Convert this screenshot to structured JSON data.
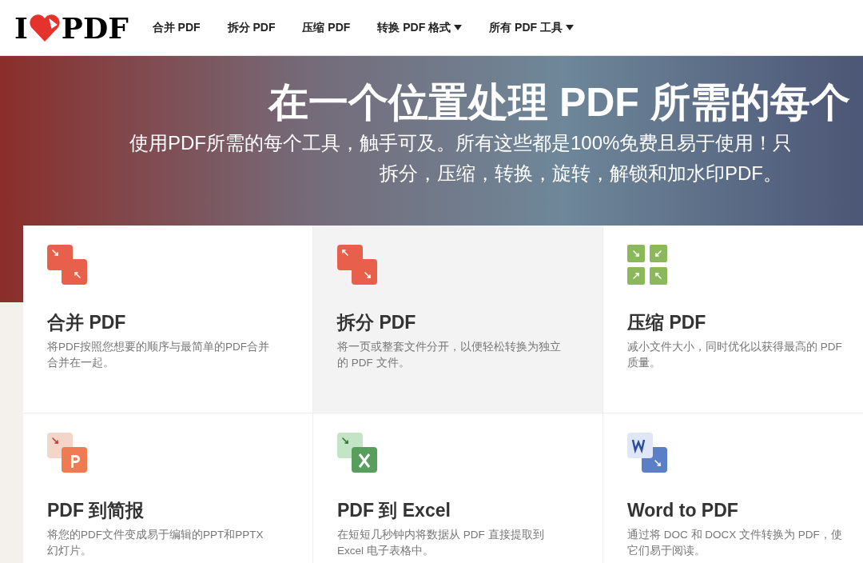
{
  "header": {
    "logo": {
      "left": "I",
      "right": "PDF"
    },
    "nav": [
      {
        "label": "合并 PDF",
        "dropdown": false
      },
      {
        "label": "拆分 PDF",
        "dropdown": false
      },
      {
        "label": "压缩 PDF",
        "dropdown": false
      },
      {
        "label": "转换 PDF 格式",
        "dropdown": true
      },
      {
        "label": "所有 PDF 工具",
        "dropdown": true
      }
    ]
  },
  "hero": {
    "title": "在一个位置处理 PDF 所需的每个",
    "subtitle_lines": [
      "使用PDF所需的每个工具，触手可及。所有这些都是100%免费且易于使用！只",
      "拆分，压缩，转换，旋转，解锁和加水印PDF。"
    ]
  },
  "tools": [
    {
      "kind": "merge",
      "title": "合并 PDF",
      "description_lines": [
        "将PDF按照您想要的顺序与最简单的PDF合并",
        "合并在一起。"
      ],
      "selected": false
    },
    {
      "kind": "split",
      "title": "拆分 PDF",
      "description_lines": [
        "将一页或整套文件分开，以便轻松转换为独立",
        "的 PDF 文件。"
      ],
      "selected": true
    },
    {
      "kind": "compress",
      "title": "压缩 PDF",
      "description_lines": [
        "减小文件大小，同时优化以获得最高的 PDF",
        "质量。"
      ],
      "selected": false
    },
    {
      "kind": "ppt",
      "title": "PDF 到简报",
      "description_lines": [
        "将您的PDF文件变成易于编辑的PPT和PPTX",
        "幻灯片。"
      ],
      "selected": false
    },
    {
      "kind": "excel",
      "title": "PDF 到 Excel",
      "description_lines": [
        "在短短几秒钟内将数据从 PDF 直接提取到",
        "Excel 电子表格中。"
      ],
      "selected": false
    },
    {
      "kind": "word",
      "title": "Word to PDF",
      "description_lines": [
        "通过将 DOC 和 DOCX 文件转换为 PDF，使",
        "它们易于阅读。"
      ],
      "selected": false
    }
  ]
}
